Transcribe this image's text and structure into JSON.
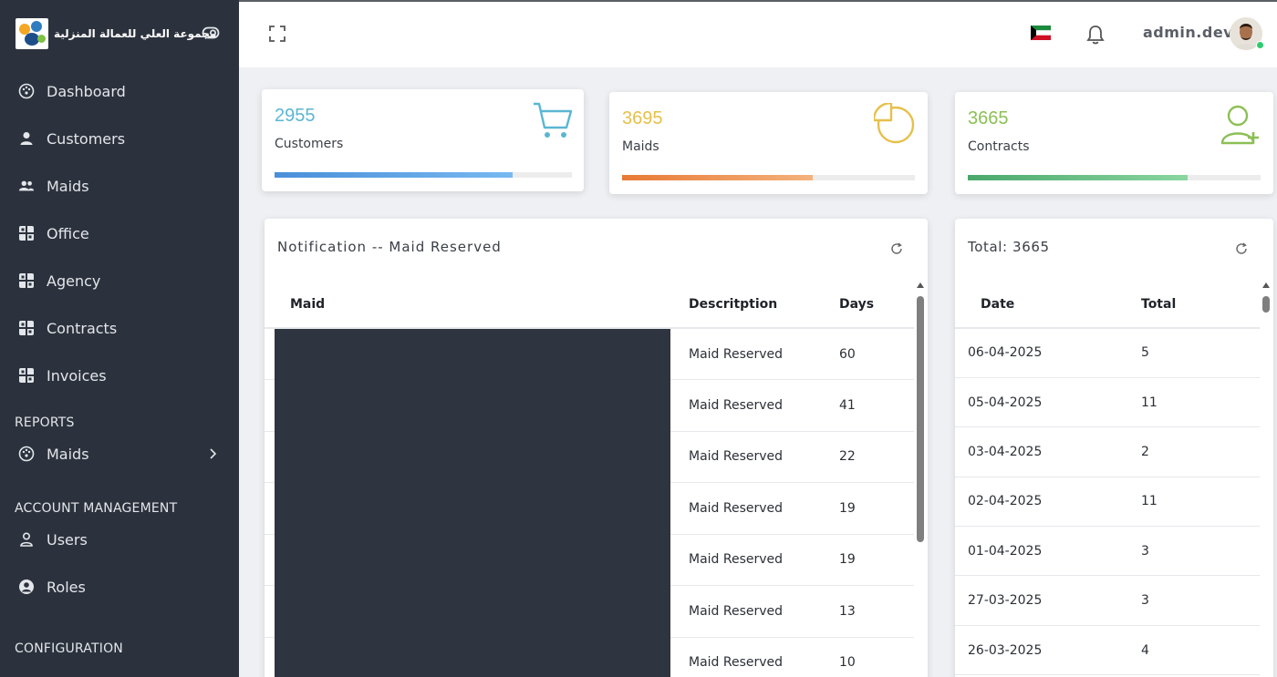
{
  "brand": {
    "name": "مجموعة العلي للعمالة المنزلية"
  },
  "sidebar": {
    "items": [
      {
        "label": "Dashboard",
        "icon": "dashboard-icon"
      },
      {
        "label": "Customers",
        "icon": "user-icon"
      },
      {
        "label": "Maids",
        "icon": "users-icon"
      },
      {
        "label": "Office",
        "icon": "grid-icon"
      },
      {
        "label": "Agency",
        "icon": "grid-icon"
      },
      {
        "label": "Contracts",
        "icon": "grid-icon"
      },
      {
        "label": "Invoices",
        "icon": "grid-icon"
      }
    ],
    "reports_label": "REPORTS",
    "reports_items": [
      {
        "label": "Maids",
        "icon": "dashboard-icon"
      }
    ],
    "account_label": "ACCOUNT MANAGEMENT",
    "account_items": [
      {
        "label": "Users",
        "icon": "user-icon"
      },
      {
        "label": "Roles",
        "icon": "user-circle-icon"
      }
    ],
    "config_label": "CONFIGURATION"
  },
  "header": {
    "username": "admin.dev"
  },
  "stats": [
    {
      "value": "2955",
      "label": "Customers",
      "progress": 0.8,
      "color": "#5bb6d3"
    },
    {
      "value": "3695",
      "label": "Maids",
      "progress": 0.65,
      "color": "#e6c04a"
    },
    {
      "value": "3665",
      "label": "Contracts",
      "progress": 0.75,
      "color": "#8cbf55"
    }
  ],
  "notifications": {
    "title": "Notification -- Maid Reserved",
    "columns": [
      "Maid",
      "Descritption",
      "Days"
    ],
    "rows": [
      {
        "desc": "Maid Reserved",
        "days": "60"
      },
      {
        "desc": "Maid Reserved",
        "days": "41"
      },
      {
        "desc": "Maid Reserved",
        "days": "22"
      },
      {
        "desc": "Maid Reserved",
        "days": "19"
      },
      {
        "desc": "Maid Reserved",
        "days": "19"
      },
      {
        "desc": "Maid Reserved",
        "days": "13"
      },
      {
        "desc": "Maid Reserved",
        "days": "10"
      }
    ]
  },
  "totals": {
    "title": "Total: 3665",
    "columns": [
      "Date",
      "Total"
    ],
    "rows": [
      {
        "date": "06-04-2025",
        "total": "5"
      },
      {
        "date": "05-04-2025",
        "total": "11"
      },
      {
        "date": "03-04-2025",
        "total": "2"
      },
      {
        "date": "02-04-2025",
        "total": "11"
      },
      {
        "date": "01-04-2025",
        "total": "3"
      },
      {
        "date": "27-03-2025",
        "total": "3"
      },
      {
        "date": "26-03-2025",
        "total": "4"
      }
    ]
  }
}
